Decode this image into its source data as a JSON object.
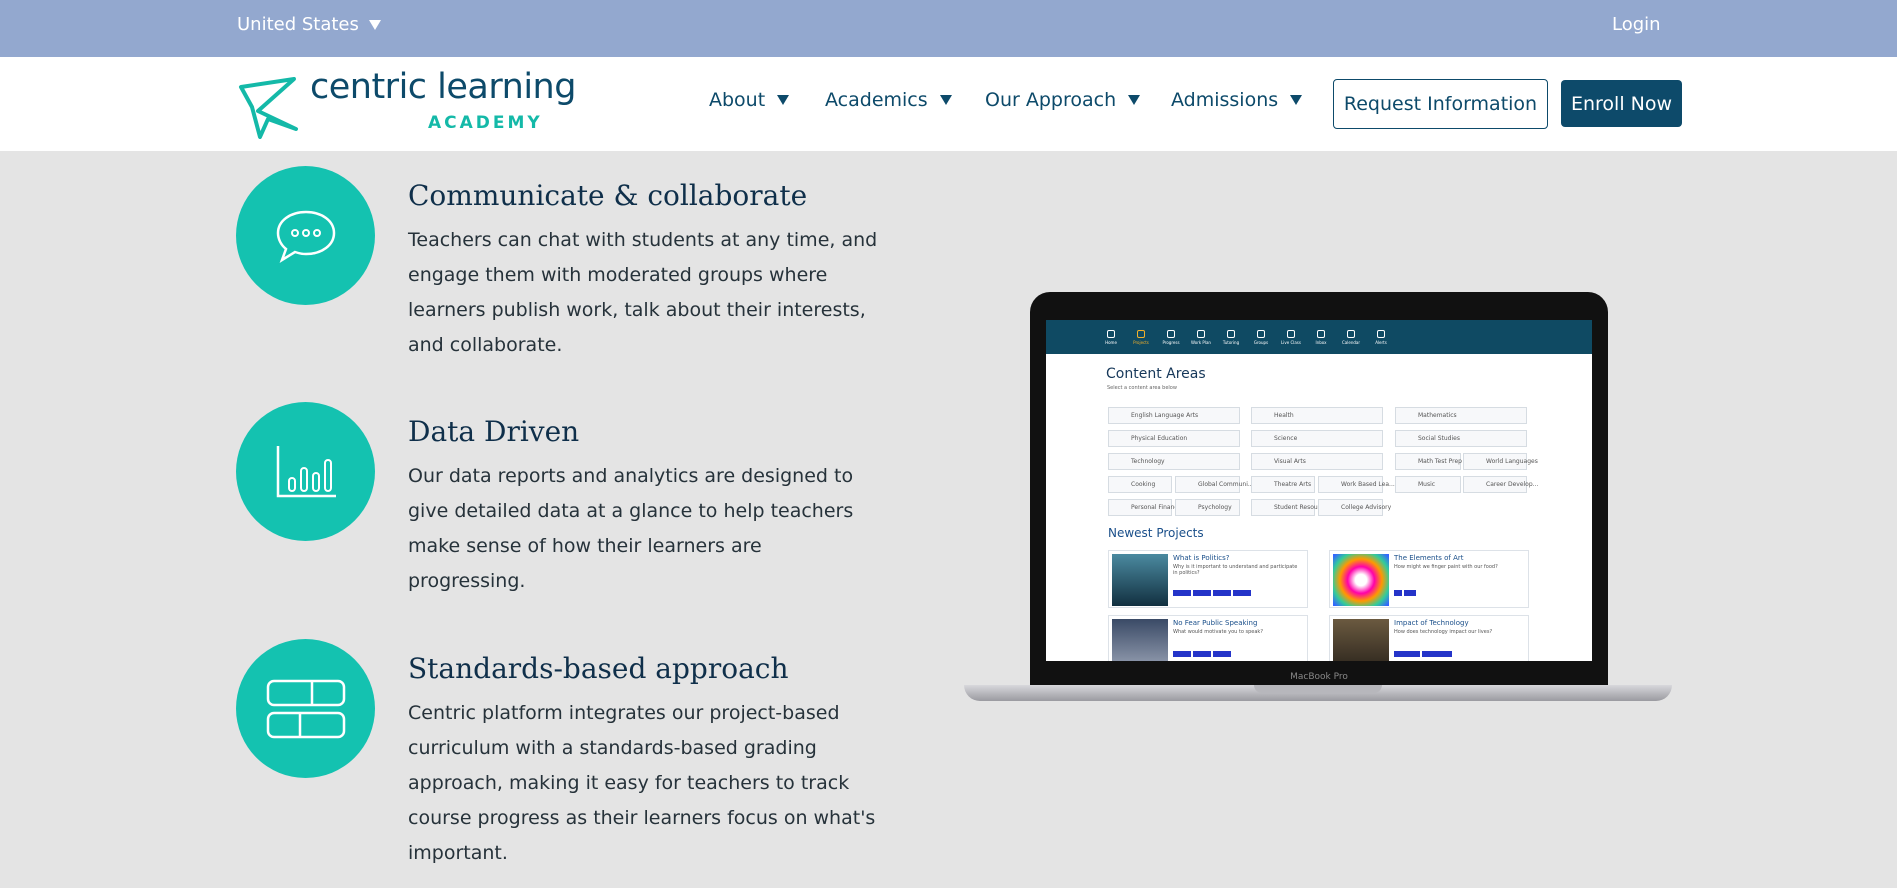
{
  "topbar": {
    "country": "United States",
    "login": "Login"
  },
  "logo": {
    "name": "centric learning",
    "sub": "ACADEMY"
  },
  "nav": [
    {
      "label": "About"
    },
    {
      "label": "Academics"
    },
    {
      "label": "Our Approach"
    },
    {
      "label": "Admissions"
    }
  ],
  "buttons": {
    "request": "Request Information",
    "enroll": "Enroll Now"
  },
  "features": [
    {
      "title": "Communicate & collaborate",
      "body": "Teachers can chat with students at any time, and engage them with moderated groups where learners publish work, talk about their interests, and collaborate.",
      "icon": "chat-bubble-icon"
    },
    {
      "title": "Data Driven",
      "body": "Our data reports and analytics are designed to give detailed data at a glance to help teachers make sense of how their learners are progressing.",
      "icon": "bar-chart-icon"
    },
    {
      "title": "Standards-based approach",
      "body": "Centric platform integrates our project-based curriculum with a standards-based grading approach, making it easy for teachers to track course progress as their learners focus on what's important.",
      "icon": "grid-blocks-icon"
    }
  ],
  "laptop": {
    "model": "MacBook Pro",
    "app_nav": [
      "Home",
      "Projects",
      "Progress",
      "Work Plan",
      "Tutoring",
      "Groups",
      "Live Class",
      "Inbox",
      "Calendar",
      "Alerts"
    ],
    "content_title": "Content Areas",
    "content_sub": "Select a content area below",
    "areas": [
      "English Language Arts",
      "Health",
      "Mathematics",
      "Physical Education",
      "Science",
      "Social Studies",
      "Technology",
      "Visual Arts",
      "Math Test Prep",
      "World Languages",
      "Cooking",
      "Global Communi...",
      "Theatre Arts",
      "Work Based Lea...",
      "Music",
      "Career Develop...",
      "Personal Finance",
      "Psychology",
      "Student Resources",
      "College Advisory"
    ],
    "newest_title": "Newest Projects",
    "projects": [
      {
        "title": "What is Politics?",
        "sub": "Why is it important to understand and participate in politics?"
      },
      {
        "title": "The Elements of Art",
        "sub": "How might we finger paint with our food?"
      },
      {
        "title": "No Fear Public Speaking",
        "sub": "What would motivate you to speak?"
      },
      {
        "title": "Impact of Technology",
        "sub": "How does technology impact our lives?"
      }
    ]
  },
  "colors": {
    "topbar": "#93a8cf",
    "brand": "#0d4a6a",
    "teal": "#14c2b0",
    "background": "#e4e4e4"
  }
}
